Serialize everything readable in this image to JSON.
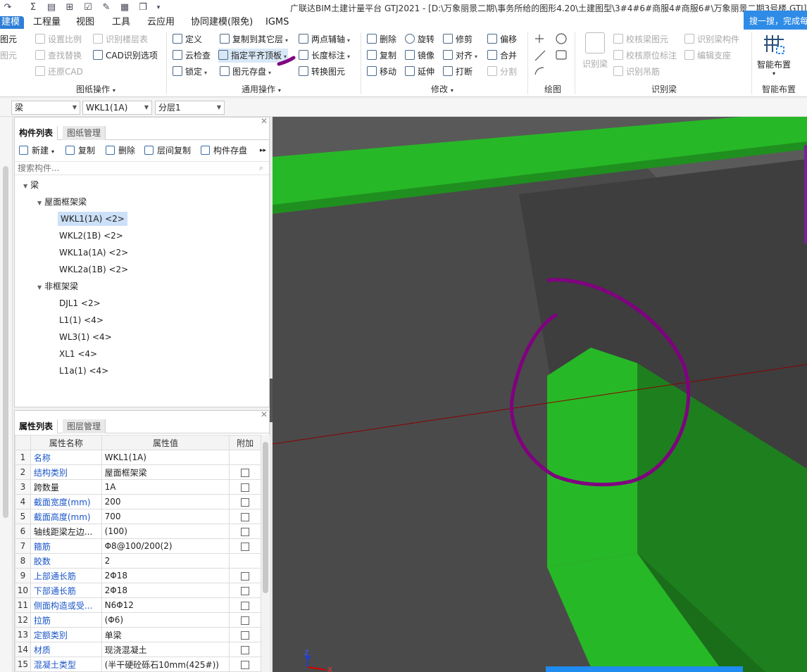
{
  "title_bar": {
    "title": "广联达BIM土建计量平台 GTJ2021 - [D:\\万象丽景二期\\事务所给的图形4.20\\土建图型\\3#4#6#商服4#商服6#\\万象丽景二期3号楼.GTJ]",
    "quick_access_icons": [
      "redo-icon",
      "sum-icon",
      "report-icon",
      "grid-calc-icon",
      "check-icon",
      "pen-icon",
      "film-icon",
      "copy-icon",
      "dropdown-icon"
    ]
  },
  "menu": {
    "tabs": [
      "建模",
      "工程量",
      "视图",
      "工具",
      "云应用",
      "协同建模(限免)",
      "IGMS"
    ],
    "active_tab": "建模"
  },
  "search_popup": "搜一搜，完成每",
  "ribbon": {
    "drawing_ops": {
      "items": [
        "图元",
        "图元",
        "设置比例",
        "识别楼层表",
        "查找替换",
        "CAD识别选项",
        "还原CAD"
      ],
      "label": "图纸操作"
    },
    "general_ops": {
      "items": [
        "定义",
        "复制到其它层",
        "两点辅轴",
        "云检查",
        "指定平齐顶板",
        "长度标注",
        "锁定",
        "图元存盘",
        "转换图元"
      ],
      "label": "通用操作"
    },
    "modify": {
      "items": [
        "删除",
        "旋转",
        "修剪",
        "偏移",
        "复制",
        "镜像",
        "对齐",
        "合并",
        "移动",
        "延伸",
        "打断",
        "分割"
      ],
      "label": "修改"
    },
    "draw": {
      "label": "绘图"
    },
    "identify_beam": {
      "big_button": "识别梁",
      "items": [
        "校核梁图元",
        "识别梁构件",
        "校核原位标注",
        "编辑支座",
        "识别吊筋"
      ],
      "label": "识别梁"
    },
    "smart_layout": {
      "big_button": "智能布置",
      "label": "智能布置"
    }
  },
  "combos": {
    "type": "梁",
    "component": "WKL1(1A)",
    "layer": "分层1"
  },
  "component_panel": {
    "tabs": [
      "构件列表",
      "图纸管理"
    ],
    "tools": [
      "新建",
      "复制",
      "删除",
      "层间复制",
      "构件存盘"
    ],
    "search_placeholder": "搜索构件...",
    "tree": {
      "root": "梁",
      "groups": [
        {
          "name": "屋面框架梁",
          "items": [
            "WKL1(1A) <2>",
            "WKL2(1B) <2>",
            "WKL1a(1A) <2>",
            "WKL2a(1B) <2>"
          ]
        },
        {
          "name": "非框架梁",
          "items": [
            "DJL1 <2>",
            "L1(1) <4>",
            "WL3(1) <4>",
            "XL1 <4>",
            "L1a(1) <4>"
          ]
        }
      ],
      "selected": "WKL1(1A) <2>"
    }
  },
  "property_panel": {
    "tabs": [
      "属性列表",
      "图层管理"
    ],
    "headers": [
      "属性名称",
      "属性值",
      "附加"
    ],
    "rows": [
      {
        "n": "1",
        "name": "名称",
        "value": "WKL1(1A)",
        "blue": true,
        "check": false
      },
      {
        "n": "2",
        "name": "结构类别",
        "value": "屋面框架梁",
        "blue": true,
        "check": true
      },
      {
        "n": "3",
        "name": "跨数量",
        "value": "1A",
        "blue": false,
        "check": true
      },
      {
        "n": "4",
        "name": "截面宽度(mm)",
        "value": "200",
        "blue": true,
        "check": true
      },
      {
        "n": "5",
        "name": "截面高度(mm)",
        "value": "700",
        "blue": true,
        "check": true
      },
      {
        "n": "6",
        "name": "轴线距梁左边...",
        "value": "(100)",
        "blue": false,
        "check": true
      },
      {
        "n": "7",
        "name": "箍筋",
        "value": "Φ8@100/200(2)",
        "blue": true,
        "check": true
      },
      {
        "n": "8",
        "name": "胶数",
        "value": "2",
        "blue": true,
        "check": false
      },
      {
        "n": "9",
        "name": "上部通长筋",
        "value": "2Φ18",
        "blue": true,
        "check": true
      },
      {
        "n": "10",
        "name": "下部通长筋",
        "value": "2Φ18",
        "blue": true,
        "check": true
      },
      {
        "n": "11",
        "name": "侧面构造或受...",
        "value": "N6Φ12",
        "blue": true,
        "check": true
      },
      {
        "n": "12",
        "name": "拉筋",
        "value": "(Φ6)",
        "blue": true,
        "check": true
      },
      {
        "n": "13",
        "name": "定额类别",
        "value": "单梁",
        "blue": true,
        "check": true
      },
      {
        "n": "14",
        "name": "材质",
        "value": "现浇混凝土",
        "blue": true,
        "check": true
      },
      {
        "n": "15",
        "name": "混凝土类型",
        "value": "(半干硬砼砾石10mm(425#))",
        "blue": true,
        "check": true
      }
    ]
  },
  "viewport": {
    "axis_labels": [
      "Z",
      "X"
    ],
    "colors": {
      "beam": "#27b827",
      "beam_dark": "#1e7f1e",
      "floor": "#4b4b4b",
      "annotation": "#800080",
      "axis_line": "#8b0000"
    }
  }
}
